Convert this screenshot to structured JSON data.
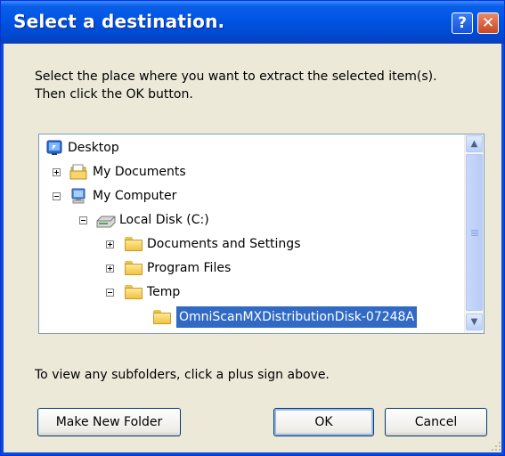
{
  "dialog": {
    "title": "Select a destination.",
    "help_glyph": "?",
    "close_glyph": "✕",
    "instruction_line1": "Select the place where you want to extract the selected item(s).",
    "instruction_line2": "Then click the OK button.",
    "hint": "To view any subfolders, click a plus sign above."
  },
  "tree": {
    "items": [
      {
        "label": "Desktop",
        "icon": "desktop-icon",
        "level": 0,
        "expander": "none"
      },
      {
        "label": "My Documents",
        "icon": "my-documents-icon",
        "level": 1,
        "expander": "plus"
      },
      {
        "label": "My Computer",
        "icon": "my-computer-icon",
        "level": 1,
        "expander": "minus"
      },
      {
        "label": "Local Disk (C:)",
        "icon": "local-disk-icon",
        "level": 2,
        "expander": "minus"
      },
      {
        "label": "Documents and Settings",
        "icon": "folder-icon",
        "level": 3,
        "expander": "plus"
      },
      {
        "label": "Program Files",
        "icon": "folder-icon",
        "level": 3,
        "expander": "plus"
      },
      {
        "label": "Temp",
        "icon": "folder-icon",
        "level": 3,
        "expander": "minus"
      },
      {
        "label": "OmniScanMXDistributionDisk-07248A",
        "icon": "folder-icon",
        "level": 4,
        "expander": "none",
        "selected": true
      }
    ],
    "scroll_up_glyph": "▲",
    "scroll_down_glyph": "▼"
  },
  "buttons": {
    "make_new_folder": "Make New Folder",
    "ok": "OK",
    "cancel": "Cancel"
  },
  "colors": {
    "titlebar": "#0054e3",
    "dialog_bg": "#ece9d8",
    "selection": "#316ac5"
  }
}
